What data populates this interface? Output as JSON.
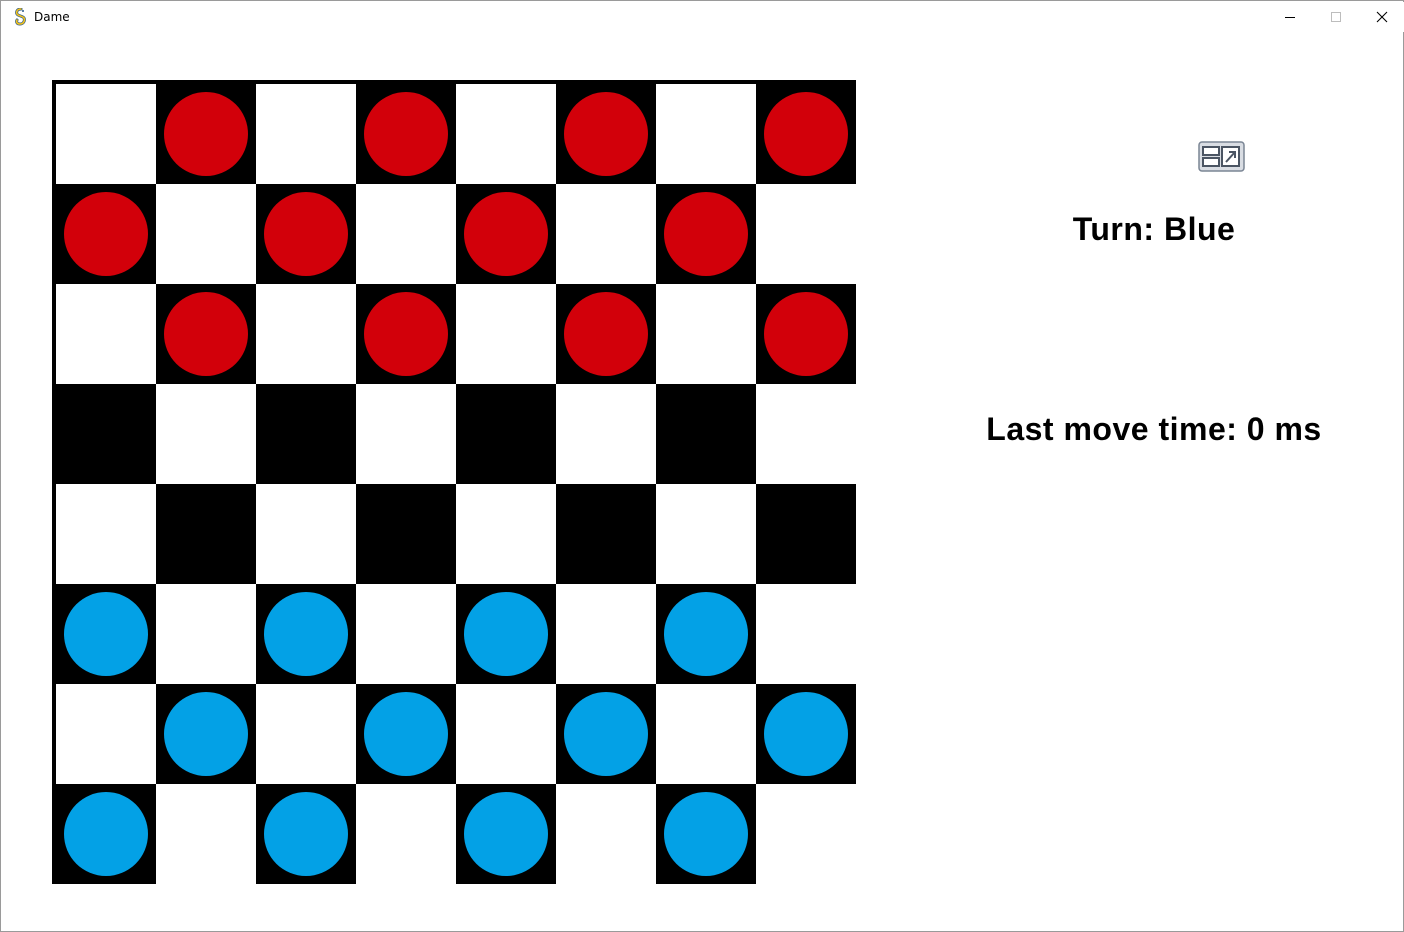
{
  "window": {
    "title": "Dame",
    "icons": {
      "app": "pygame-snake-icon",
      "minimize": "minimize-icon",
      "maximize": "maximize-icon",
      "close": "close-icon"
    }
  },
  "board": {
    "size": 8,
    "colors": {
      "light": "#ffffff",
      "dark": "#000000",
      "red": "#d2000a",
      "blue": "#03a1e6"
    },
    "rows": [
      ".r.r.r.r",
      "r.r.r.r.",
      ".r.r.r.r",
      "........",
      "........",
      "b.b.b.b.",
      ".b.b.b.b",
      "b.b.b.b."
    ]
  },
  "side_panel": {
    "icon": "window-switch-icon",
    "turn_text": "Turn: Blue",
    "move_time_text": "Last move time: 0 ms"
  }
}
